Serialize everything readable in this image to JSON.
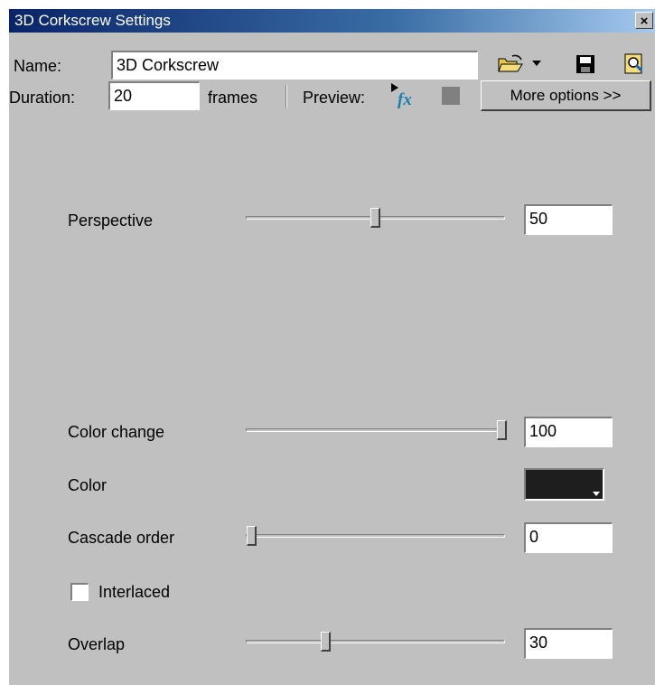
{
  "window": {
    "title": "3D Corkscrew Settings",
    "close_glyph": "×"
  },
  "header": {
    "name_label": "Name:",
    "name_value": "3D Corkscrew",
    "duration_label": "Duration:",
    "duration_value": "20",
    "duration_unit": "frames",
    "preview_label": "Preview:",
    "more_options_label": "More options >>"
  },
  "icons": {
    "open": "folder-open-icon",
    "dropdown": "dropdown-arrow-icon",
    "save": "save-icon",
    "find": "find-icon",
    "preview_fx": "preview-fx-icon",
    "stop": "stop-icon"
  },
  "settings": {
    "perspective": {
      "label": "Perspective",
      "value": "50",
      "slider_fraction": 0.5
    },
    "color_change": {
      "label": "Color change",
      "value": "100",
      "slider_fraction": 1.0
    },
    "color": {
      "label": "Color",
      "swatch": "#1e1e1e"
    },
    "cascade_order": {
      "label": "Cascade order",
      "value": "0",
      "slider_fraction": 0.0
    },
    "interlaced": {
      "label": "Interlaced",
      "checked": false
    },
    "overlap": {
      "label": "Overlap",
      "value": "30",
      "slider_fraction": 0.3
    }
  },
  "colors": {
    "title_bar": "#0a246a",
    "dialog_bg": "#c0c0c0"
  }
}
